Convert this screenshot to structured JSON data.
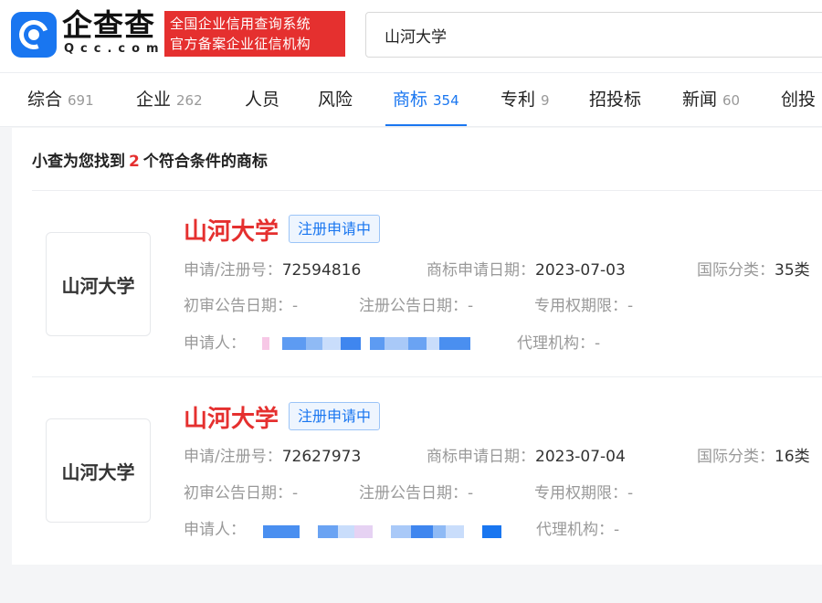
{
  "header": {
    "logo_name": "企查查",
    "logo_sub": "Qcc.com",
    "slogan_line1": "全国企业信用查询系统",
    "slogan_line2": "官方备案企业征信机构",
    "search_value": "山河大学"
  },
  "tabs": [
    {
      "label": "综合",
      "count": "691",
      "active": false
    },
    {
      "label": "企业",
      "count": "262",
      "active": false
    },
    {
      "label": "人员",
      "count": "",
      "active": false
    },
    {
      "label": "风险",
      "count": "",
      "active": false
    },
    {
      "label": "商标",
      "count": "354",
      "active": true
    },
    {
      "label": "专利",
      "count": "9",
      "active": false
    },
    {
      "label": "招投标",
      "count": "",
      "active": false
    },
    {
      "label": "新闻",
      "count": "60",
      "active": false
    },
    {
      "label": "创投",
      "count": "",
      "active": false
    }
  ],
  "results": {
    "prefix": "小查为您找到",
    "count": "2",
    "suffix": "个符合条件的商标"
  },
  "labels": {
    "reg_no": "申请/注册号：",
    "apply_date": "商标申请日期：",
    "intl_class": "国际分类：",
    "prelim_date": "初审公告日期：",
    "reg_date": "注册公告日期：",
    "exclusive_period": "专用权期限：",
    "applicant": "申请人：",
    "agency": "代理机构："
  },
  "cards": [
    {
      "thumb_text": "山河大学",
      "name": "山河大学",
      "status": "注册申请中",
      "reg_no": "72594816",
      "apply_date": "2023-07-03",
      "intl_class": "35类",
      "prelim_date": "-",
      "reg_date": "-",
      "exclusive_period": "-",
      "agency": "-"
    },
    {
      "thumb_text": "山河大学",
      "name": "山河大学",
      "status": "注册申请中",
      "reg_no": "72627973",
      "apply_date": "2023-07-04",
      "intl_class": "16类",
      "prelim_date": "-",
      "reg_date": "-",
      "exclusive_period": "-",
      "agency": "-"
    }
  ],
  "colors": {
    "brand_blue": "#1976f0",
    "brand_red": "#e5302f",
    "mosaic_blue": "#4a8ff0",
    "mosaic_pink": "#f7c8e6"
  }
}
